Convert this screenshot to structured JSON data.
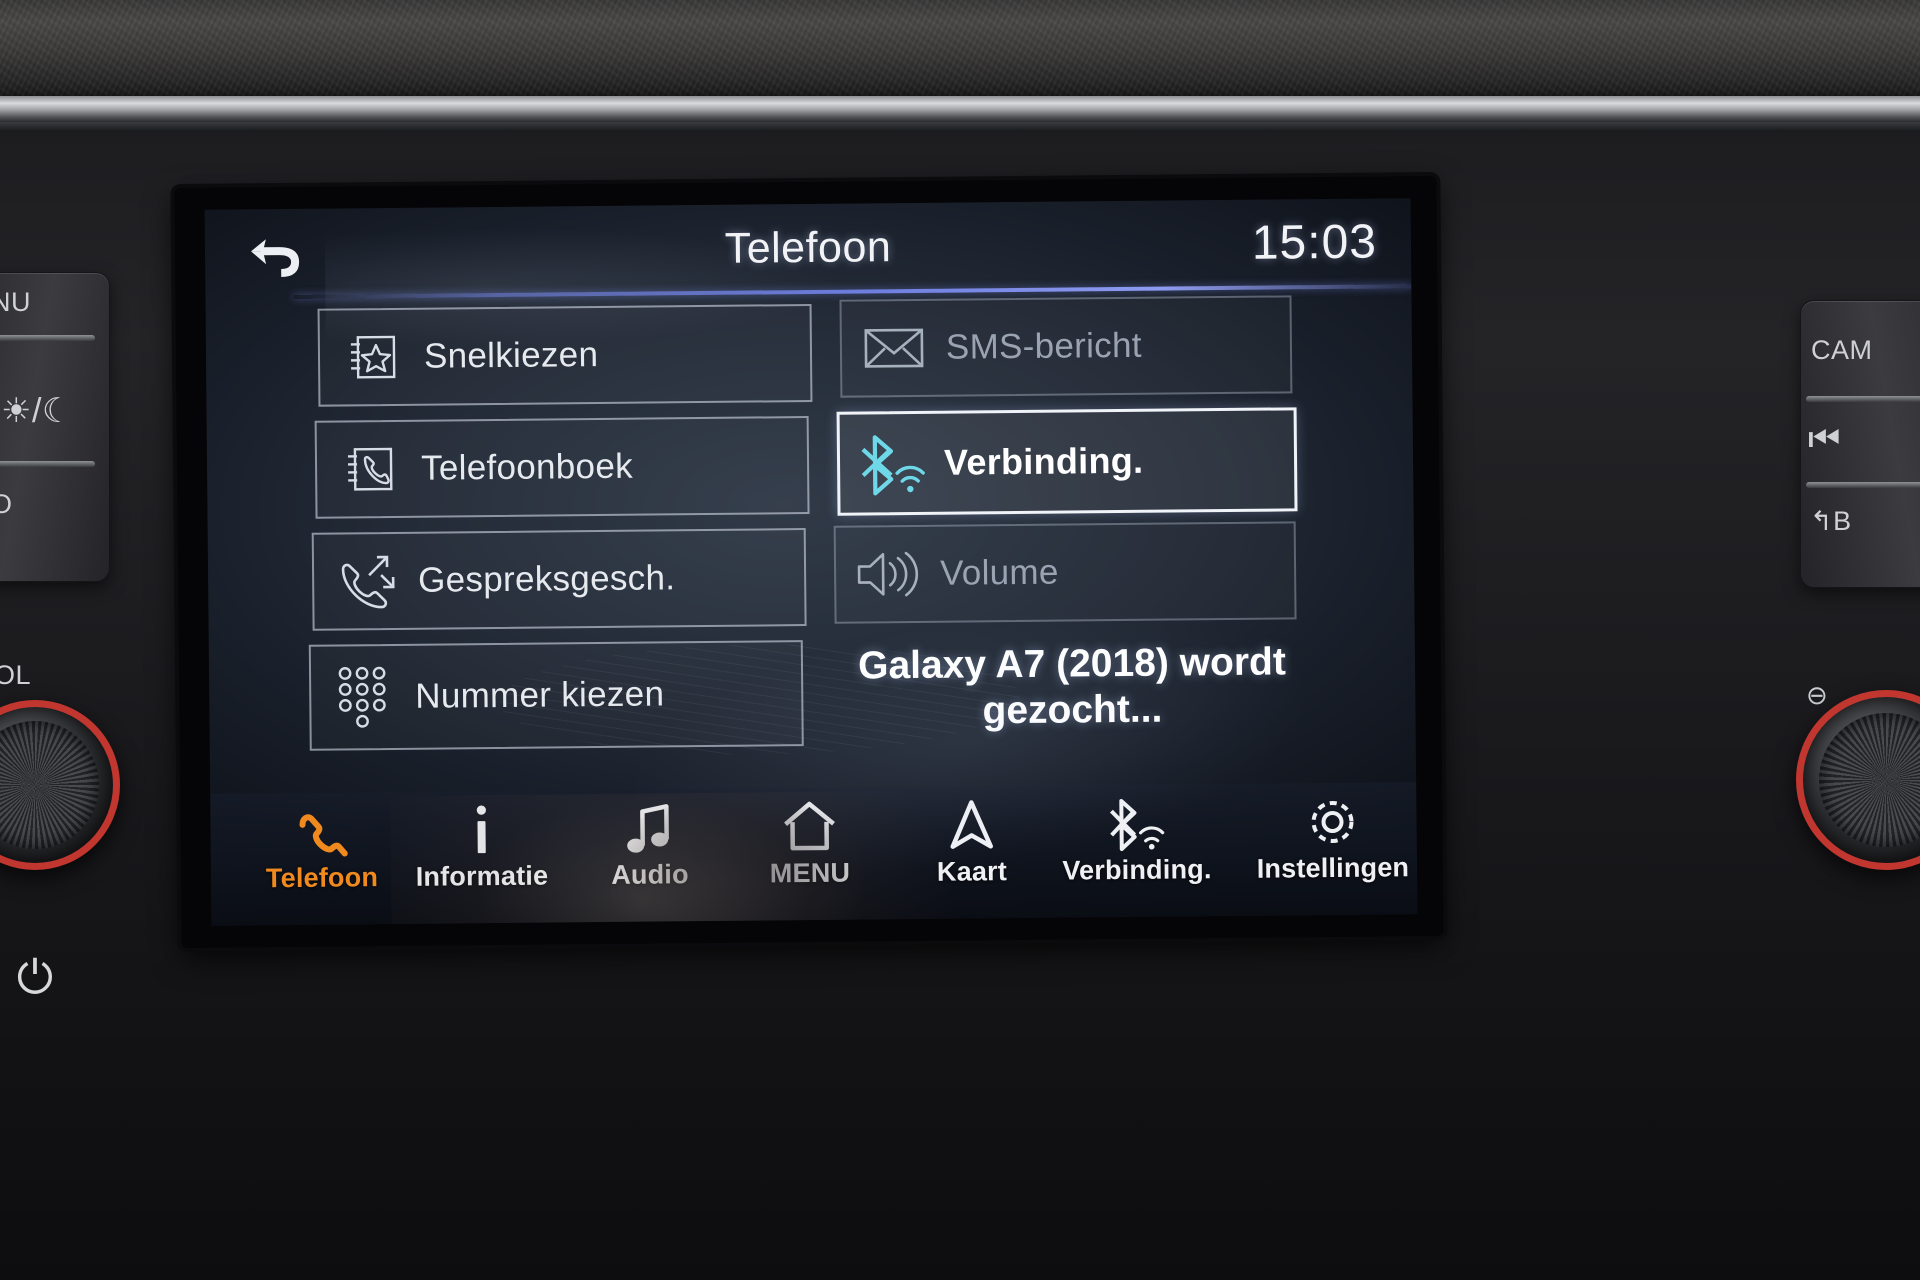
{
  "header": {
    "back_icon": "back-arrow-icon",
    "title": "Telefoon",
    "clock": "15:03"
  },
  "menu": {
    "left_column": [
      {
        "id": "snelkiezen",
        "label": "Snelkiezen",
        "icon": "speed-dial-star-icon",
        "state": "normal"
      },
      {
        "id": "telefoonboek",
        "label": "Telefoonboek",
        "icon": "phonebook-icon",
        "state": "normal"
      },
      {
        "id": "gesprek",
        "label": "Gespreksgesch.",
        "icon": "call-history-icon",
        "state": "normal"
      },
      {
        "id": "nummer",
        "label": "Nummer kiezen",
        "icon": "dialpad-icon",
        "state": "normal"
      }
    ],
    "right_column": [
      {
        "id": "sms",
        "label": "SMS-bericht",
        "icon": "envelope-icon",
        "state": "disabled"
      },
      {
        "id": "verbinding",
        "label": "Verbinding.",
        "icon": "bluetooth-wifi-icon",
        "state": "selected"
      },
      {
        "id": "volume",
        "label": "Volume",
        "icon": "speaker-icon",
        "state": "disabled"
      }
    ]
  },
  "status": {
    "message": "Galaxy A7 (2018) wordt gezocht..."
  },
  "navbar": {
    "items": [
      {
        "id": "telefoon",
        "label": "Telefoon",
        "icon": "phone-handset-icon",
        "active": true
      },
      {
        "id": "informatie",
        "label": "Informatie",
        "icon": "info-icon",
        "active": false
      },
      {
        "id": "audio",
        "label": "Audio",
        "icon": "music-note-icon",
        "active": false
      },
      {
        "id": "menu",
        "label": "MENU",
        "icon": "home-icon",
        "active": false
      },
      {
        "id": "kaart",
        "label": "Kaart",
        "icon": "navigation-arrow-icon",
        "active": false
      },
      {
        "id": "verbinding",
        "label": "Verbinding.",
        "icon": "bluetooth-wifi-icon",
        "active": false
      },
      {
        "id": "instellingen",
        "label": "Instellingen",
        "icon": "gear-icon",
        "active": false
      }
    ]
  },
  "hardware": {
    "left": {
      "menu_label": "NU",
      "display_label": "O",
      "volume_label": "OL",
      "power_icon": "power-icon",
      "brightness_icon": "sun-moon-icon"
    },
    "right": {
      "camera_label": "CAM",
      "prev_track_icon": "previous-track-icon",
      "back_label": "B",
      "zoom_label": "⊖"
    }
  },
  "colors": {
    "accent_orange": "#f08a1e",
    "bluetooth_cyan": "#6fd8e8",
    "divider_blue": "#6f7fe0",
    "screen_bg": "#222a36",
    "text_primary": "#f2f3f6",
    "text_dim": "#9aa3b2"
  }
}
